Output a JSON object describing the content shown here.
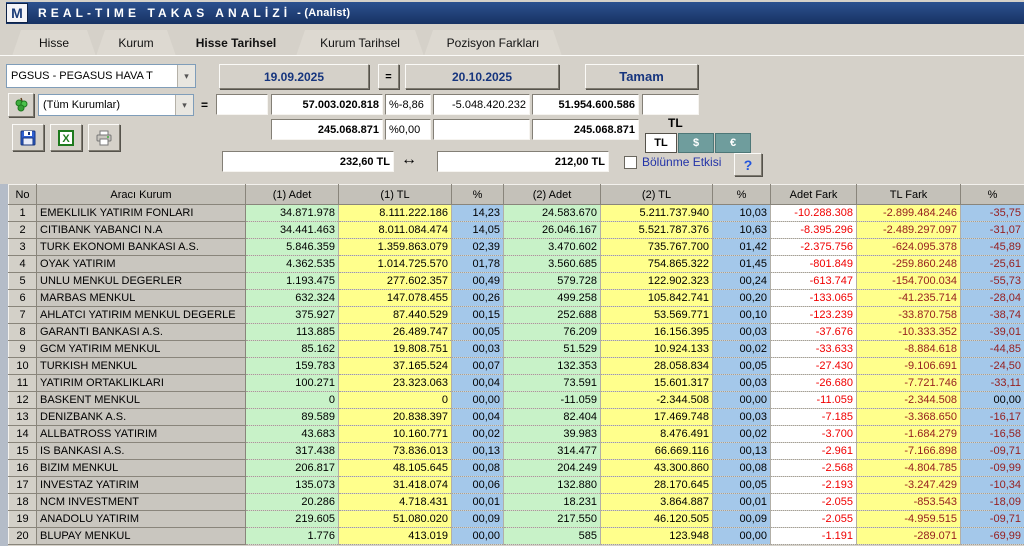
{
  "title_bar": {
    "logo": "M",
    "title": "REAL-TIME TAKAS ANALİZİ",
    "subtitle": "- (Analist)"
  },
  "tabs": [
    {
      "label": "Hisse"
    },
    {
      "label": "Kurum"
    },
    {
      "label": "Hisse Tarihsel",
      "active": true
    },
    {
      "label": "Kurum Tarihsel"
    },
    {
      "label": "Pozisyon Farkları"
    }
  ],
  "controls": {
    "stock_select": "PGSUS - PEGASUS HAVA T",
    "date_from": "19.09.2025",
    "equals_button": "=",
    "date_to": "20.10.2025",
    "ok_button": "Tamam",
    "kurum_select": "(Tüm Kurumlar)",
    "equals_label": "=",
    "filter_value": "",
    "total1": "57.003.020.818",
    "pct1": "%-8,86",
    "diff1": "-5.048.420.232",
    "total2": "51.954.600.586",
    "extra1": "",
    "adet_total1": "245.068.871",
    "pct2": "%0,00",
    "extra2": "",
    "adet_total2": "245.068.871",
    "currency_label": "TL",
    "currency_tl": "TL",
    "currency_usd": "$",
    "currency_eur": "€",
    "price_from": "232,60 TL",
    "arrow": "↔",
    "price_to": "212,00 TL",
    "split_checkbox_label": "Bölünme Etkisi",
    "help_glyph": "?"
  },
  "table": {
    "headers": [
      "No",
      "Aracı Kurum",
      "(1) Adet",
      "(1) TL",
      "%",
      "(2) Adet",
      "(2) TL",
      "%",
      "Adet Fark",
      "TL Fark",
      "%"
    ],
    "rows": [
      [
        "1",
        "EMEKLILIK YATIRIM FONLARI",
        "34.871.978",
        "8.111.222.186",
        "14,23",
        "24.583.670",
        "5.211.737.940",
        "10,03",
        "-10.288.308",
        "-2.899.484.246",
        "-35,75"
      ],
      [
        "2",
        "CITIBANK YABANCI N.A",
        "34.441.463",
        "8.011.084.474",
        "14,05",
        "26.046.167",
        "5.521.787.376",
        "10,63",
        "-8.395.296",
        "-2.489.297.097",
        "-31,07"
      ],
      [
        "3",
        "TURK EKONOMI BANKASI A.S.",
        "5.846.359",
        "1.359.863.079",
        "02,39",
        "3.470.602",
        "735.767.700",
        "01,42",
        "-2.375.756",
        "-624.095.378",
        "-45,89"
      ],
      [
        "4",
        "OYAK YATIRIM",
        "4.362.535",
        "1.014.725.570",
        "01,78",
        "3.560.685",
        "754.865.322",
        "01,45",
        "-801.849",
        "-259.860.248",
        "-25,61"
      ],
      [
        "5",
        "UNLU MENKUL DEGERLER",
        "1.193.475",
        "277.602.357",
        "00,49",
        "579.728",
        "122.902.323",
        "00,24",
        "-613.747",
        "-154.700.034",
        "-55,73"
      ],
      [
        "6",
        "MARBAS MENKUL",
        "632.324",
        "147.078.455",
        "00,26",
        "499.258",
        "105.842.741",
        "00,20",
        "-133.065",
        "-41.235.714",
        "-28,04"
      ],
      [
        "7",
        "AHLATCI YATIRIM MENKUL DEGERLE",
        "375.927",
        "87.440.529",
        "00,15",
        "252.688",
        "53.569.771",
        "00,10",
        "-123.239",
        "-33.870.758",
        "-38,74"
      ],
      [
        "8",
        "GARANTI BANKASI A.S.",
        "113.885",
        "26.489.747",
        "00,05",
        "76.209",
        "16.156.395",
        "00,03",
        "-37.676",
        "-10.333.352",
        "-39,01"
      ],
      [
        "9",
        "GCM YATIRIM MENKUL",
        "85.162",
        "19.808.751",
        "00,03",
        "51.529",
        "10.924.133",
        "00,02",
        "-33.633",
        "-8.884.618",
        "-44,85"
      ],
      [
        "10",
        "TURKISH MENKUL",
        "159.783",
        "37.165.524",
        "00,07",
        "132.353",
        "28.058.834",
        "00,05",
        "-27.430",
        "-9.106.691",
        "-24,50"
      ],
      [
        "11",
        "YATIRIM ORTAKLIKLARI",
        "100.271",
        "23.323.063",
        "00,04",
        "73.591",
        "15.601.317",
        "00,03",
        "-26.680",
        "-7.721.746",
        "-33,11"
      ],
      [
        "12",
        "BASKENT MENKUL",
        "0",
        "0",
        "00,00",
        "-11.059",
        "-2.344.508",
        "00,00",
        "-11.059",
        "-2.344.508",
        "00,00"
      ],
      [
        "13",
        "DENIZBANK A.S.",
        "89.589",
        "20.838.397",
        "00,04",
        "82.404",
        "17.469.748",
        "00,03",
        "-7.185",
        "-3.368.650",
        "-16,17"
      ],
      [
        "14",
        "ALLBATROSS YATIRIM",
        "43.683",
        "10.160.771",
        "00,02",
        "39.983",
        "8.476.491",
        "00,02",
        "-3.700",
        "-1.684.279",
        "-16,58"
      ],
      [
        "15",
        "IS BANKASI A.S.",
        "317.438",
        "73.836.013",
        "00,13",
        "314.477",
        "66.669.116",
        "00,13",
        "-2.961",
        "-7.166.898",
        "-09,71"
      ],
      [
        "16",
        "BIZIM MENKUL",
        "206.817",
        "48.105.645",
        "00,08",
        "204.249",
        "43.300.860",
        "00,08",
        "-2.568",
        "-4.804.785",
        "-09,99"
      ],
      [
        "17",
        "INVESTAZ YATIRIM",
        "135.073",
        "31.418.074",
        "00,06",
        "132.880",
        "28.170.645",
        "00,05",
        "-2.193",
        "-3.247.429",
        "-10,34"
      ],
      [
        "18",
        "NCM INVESTMENT",
        "20.286",
        "4.718.431",
        "00,01",
        "18.231",
        "3.864.887",
        "00,01",
        "-2.055",
        "-853.543",
        "-18,09"
      ],
      [
        "19",
        "ANADOLU YATIRIM",
        "219.605",
        "51.080.020",
        "00,09",
        "217.550",
        "46.120.505",
        "00,09",
        "-2.055",
        "-4.959.515",
        "-09,71"
      ],
      [
        "20",
        "BLUPAY MENKUL",
        "1.776",
        "413.019",
        "00,00",
        "585",
        "123.948",
        "00,00",
        "-1.191",
        "-289.071",
        "-69,99"
      ]
    ]
  },
  "colors": {
    "titlebar": "#1b3c78",
    "adet_column": "#c8f2c8",
    "tl_column": "#ffff8c",
    "pct_column": "#a4c8ea",
    "negative_bright": "#f00000",
    "negative_dark": "#962020",
    "currency_off": "#6f9d9d",
    "date_text": "#16357e"
  }
}
